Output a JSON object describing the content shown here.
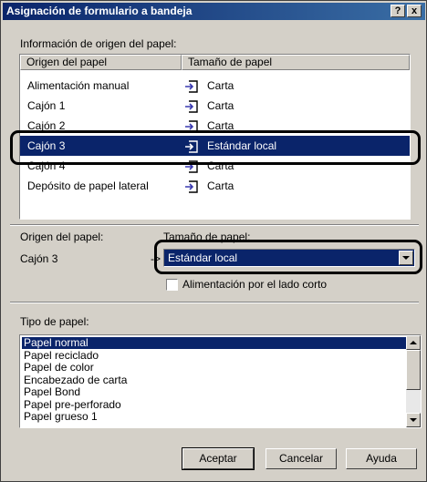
{
  "window": {
    "title": "Asignación de formulario a bandeja",
    "help_label": "?",
    "close_label": "x"
  },
  "source_info_label": "Información de origen del papel:",
  "source_table": {
    "headers": [
      "Origen del papel",
      "Tamaño de papel"
    ],
    "rows": [
      {
        "source": "Alimentación manual",
        "size": "Carta",
        "icon": "paper-in-icon",
        "selected": false
      },
      {
        "source": "Cajón 1",
        "size": "Carta",
        "icon": "paper-in-icon",
        "selected": false
      },
      {
        "source": "Cajón 2",
        "size": "Carta",
        "icon": "paper-in-icon",
        "selected": false
      },
      {
        "source": "Cajón 3",
        "size": "Estándar local",
        "icon": "paper-in-icon",
        "selected": true
      },
      {
        "source": "Cajón 4",
        "size": "Carta",
        "icon": "paper-in-icon",
        "selected": false
      },
      {
        "source": "Depósito de papel lateral",
        "size": "Carta",
        "icon": "paper-in-icon",
        "selected": false
      }
    ]
  },
  "selection": {
    "source_label": "Origen del papel:",
    "source_value": "Cajón 3",
    "arrow": "->",
    "size_label": "Tamaño de papel:",
    "size_value": "Estándar local",
    "short_edge_label": "Alimentación por el lado corto",
    "short_edge_checked": false
  },
  "paper_type": {
    "label": "Tipo de papel:",
    "items": [
      "Papel normal",
      "Papel reciclado",
      "Papel de color",
      "Encabezado de carta",
      "Papel Bond",
      "Papel pre-perforado",
      "Papel grueso 1"
    ],
    "selected_index": 0
  },
  "buttons": {
    "ok": "Aceptar",
    "cancel": "Cancelar",
    "help": "Ayuda"
  },
  "colors": {
    "title_bar": "#0a246a",
    "selection": "#0a246a",
    "dialog_face": "#d4d0c8",
    "callout": "#000000"
  }
}
